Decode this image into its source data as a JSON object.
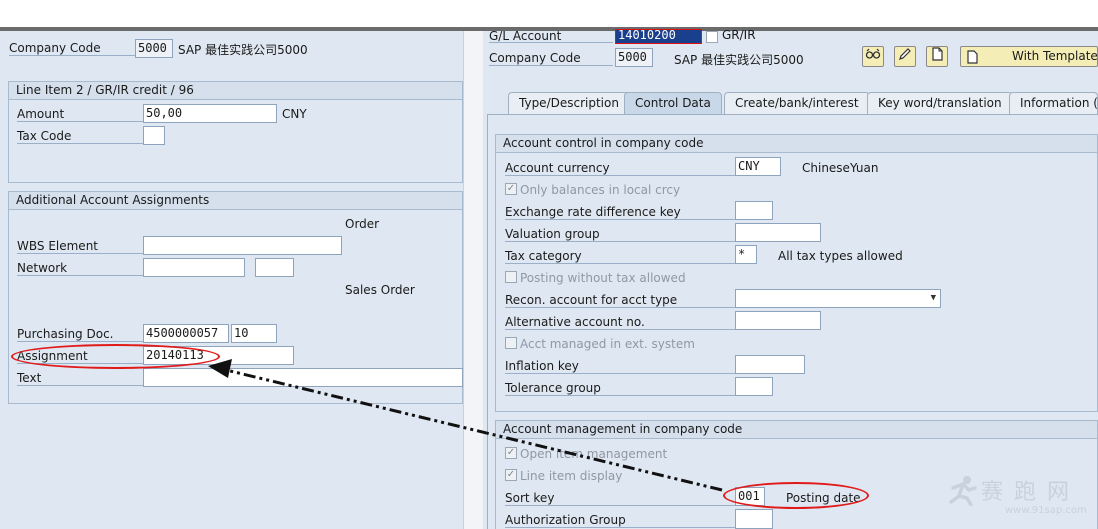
{
  "left": {
    "company_code_label": "Company Code",
    "company_code_value": "5000",
    "company_name": "SAP 最佳实践公司5000",
    "line_item_title": "Line Item 2 / GR/IR credit / 96",
    "amount_label": "Amount",
    "amount_value": "50,00",
    "currency": "CNY",
    "tax_code_label": "Tax Code",
    "tax_code_value": "",
    "additional_title": "Additional Account Assignments",
    "order_label": "Order",
    "wbs_label": "WBS Element",
    "network_label": "Network",
    "sales_order_label": "Sales Order",
    "purchasing_doc_label": "Purchasing Doc.",
    "purchasing_doc_value": "4500000057",
    "purchasing_item_value": "10",
    "assignment_label": "Assignment",
    "assignment_value": "20140113",
    "text_label": "Text"
  },
  "right": {
    "gl_account_label": "G/L Account",
    "gl_account_value": "14010200",
    "gr_ir_label": "GR/IR",
    "company_code_label": "Company Code",
    "company_code_value": "5000",
    "company_name": "SAP 最佳实践公司5000",
    "with_template_label": "With Template",
    "tabs": [
      {
        "label": "Type/Description",
        "active": false
      },
      {
        "label": "Control Data",
        "active": true
      },
      {
        "label": "Create/bank/interest",
        "active": false
      },
      {
        "label": "Key word/translation",
        "active": false
      },
      {
        "label": "Information (C",
        "active": false
      }
    ],
    "control_group_title": "Account control in company code",
    "account_currency_label": "Account currency",
    "account_currency_value": "CNY",
    "account_currency_text": "ChineseYuan",
    "only_balances_label": "Only balances in local crcy",
    "exchange_rate_label": "Exchange rate difference key",
    "valuation_group_label": "Valuation group",
    "tax_category_label": "Tax category",
    "tax_category_value": "*",
    "tax_category_text": "All tax types allowed",
    "posting_without_tax_label": "Posting without tax allowed",
    "recon_account_label": "Recon. account for acct type",
    "alternative_account_label": "Alternative account no.",
    "acct_managed_label": "Acct managed in ext. system",
    "inflation_key_label": "Inflation key",
    "tolerance_group_label": "Tolerance group",
    "management_group_title": "Account management in company code",
    "open_item_label": "Open item management",
    "line_item_display_label": "Line item display",
    "sort_key_label": "Sort key",
    "sort_key_value": "001",
    "sort_key_text": "Posting date",
    "authorization_group_label": "Authorization Group"
  },
  "watermark": {
    "chars": "赛 跑 网",
    "url": "www.91sap.com"
  },
  "colors": {
    "pane_bg": "#dfe8f2",
    "annotation_red": "#e01b1b",
    "toolbar_button_bg": "#f4eeb6"
  }
}
